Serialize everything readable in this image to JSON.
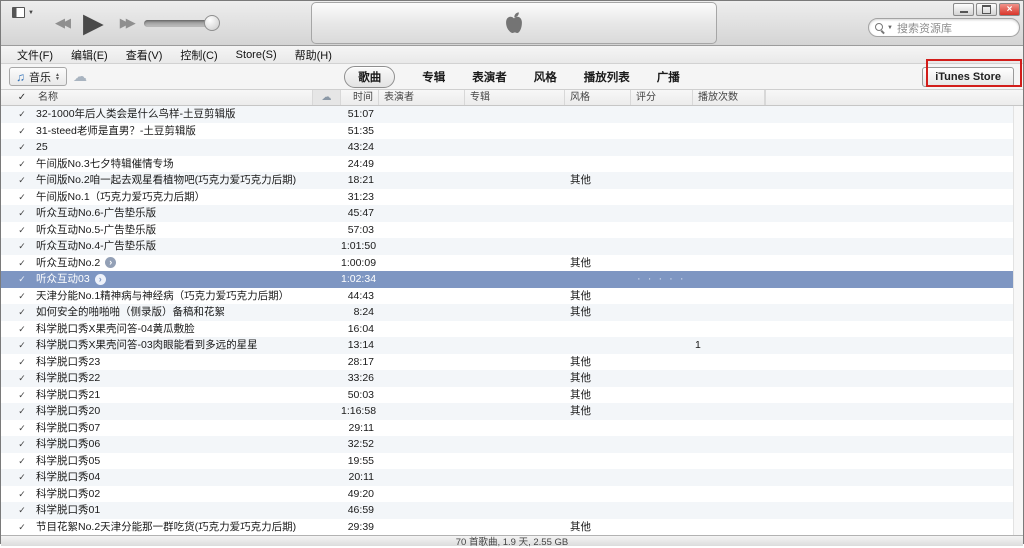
{
  "icons": {
    "check": "✓",
    "cloud": "☁",
    "arrow": "›",
    "music_note": "♫",
    "rewind": "◀◀",
    "play": "▶",
    "forward": "▶▶",
    "selector_up": "▲",
    "selector_down": "▼",
    "search_caret": "▼",
    "close": "×"
  },
  "colors": {
    "selected_row": "#7e96c2",
    "alt_row": "#f3f6f9",
    "annotation_red": "#d21d1a"
  },
  "titlebar": {
    "search_placeholder": "搜索资源库"
  },
  "menu": {
    "items": [
      "文件(F)",
      "编辑(E)",
      "查看(V)",
      "控制(C)",
      "Store(S)",
      "帮助(H)"
    ]
  },
  "toolbar": {
    "media_selector": "音乐",
    "tabs": [
      "歌曲",
      "专辑",
      "表演者",
      "风格",
      "播放列表",
      "广播"
    ],
    "selected_tab": "歌曲",
    "store_button": "iTunes Store"
  },
  "columns": {
    "name": "名称",
    "time": "时间",
    "artist": "表演者",
    "album": "专辑",
    "genre": "风格",
    "rating": "评分",
    "plays": "播放次数"
  },
  "rating_placeholder": "· · · · ·",
  "songs": [
    {
      "name": "32-1000年后人类会是什么鸟样-土豆剪辑版",
      "time": "51:07"
    },
    {
      "name": "31-steed老师是直男？-土豆剪辑版",
      "time": "51:35"
    },
    {
      "name": "25",
      "time": "43:24"
    },
    {
      "name": "午间版No.3七夕特辑催情专场",
      "time": "24:49"
    },
    {
      "name": "午间版No.2咱一起去观星看植物吧(巧克力爱巧克力后期)",
      "time": "18:21",
      "genre": "其他"
    },
    {
      "name": "午间版No.1（巧克力爱巧克力后期）",
      "time": "31:23"
    },
    {
      "name": "听众互动No.6-广告垫乐版",
      "time": "45:47"
    },
    {
      "name": "听众互动No.5-广告垫乐版",
      "time": "57:03"
    },
    {
      "name": "听众互动No.4-广告垫乐版",
      "time": "1:01:50"
    },
    {
      "name": "听众互动No.2",
      "time": "1:00:09",
      "genre": "其他",
      "arrow": true
    },
    {
      "name": "听众互动03",
      "time": "1:02:34",
      "arrow": true,
      "selected": true
    },
    {
      "name": "天津分能No.1精神病与神经病（巧克力爱巧克力后期）",
      "time": "44:43",
      "genre": "其他"
    },
    {
      "name": "如何安全的啪啪啪（侧录版）备稿和花絮",
      "time": "8:24",
      "genre": "其他"
    },
    {
      "name": "科学脱口秀X果壳问答-04黄瓜敷脸",
      "time": "16:04"
    },
    {
      "name": "科学脱口秀X果壳问答-03肉眼能看到多远的星星",
      "time": "13:14",
      "play_count": "1"
    },
    {
      "name": "科学脱口秀23",
      "time": "28:17",
      "genre": "其他"
    },
    {
      "name": "科学脱口秀22",
      "time": "33:26",
      "genre": "其他"
    },
    {
      "name": "科学脱口秀21",
      "time": "50:03",
      "genre": "其他"
    },
    {
      "name": "科学脱口秀20",
      "time": "1:16:58",
      "genre": "其他"
    },
    {
      "name": "科学脱口秀07",
      "time": "29:11"
    },
    {
      "name": "科学脱口秀06",
      "time": "32:52"
    },
    {
      "name": "科学脱口秀05",
      "time": "19:55"
    },
    {
      "name": "科学脱口秀04",
      "time": "20:11"
    },
    {
      "name": "科学脱口秀02",
      "time": "49:20"
    },
    {
      "name": "科学脱口秀01",
      "time": "46:59"
    },
    {
      "name": "节目花絮No.2天津分能那一群吃货(巧克力爱巧克力后期)",
      "time": "29:39",
      "genre": "其他"
    }
  ],
  "status": {
    "summary": "70 首歌曲, 1.9 天, 2.55 GB"
  }
}
